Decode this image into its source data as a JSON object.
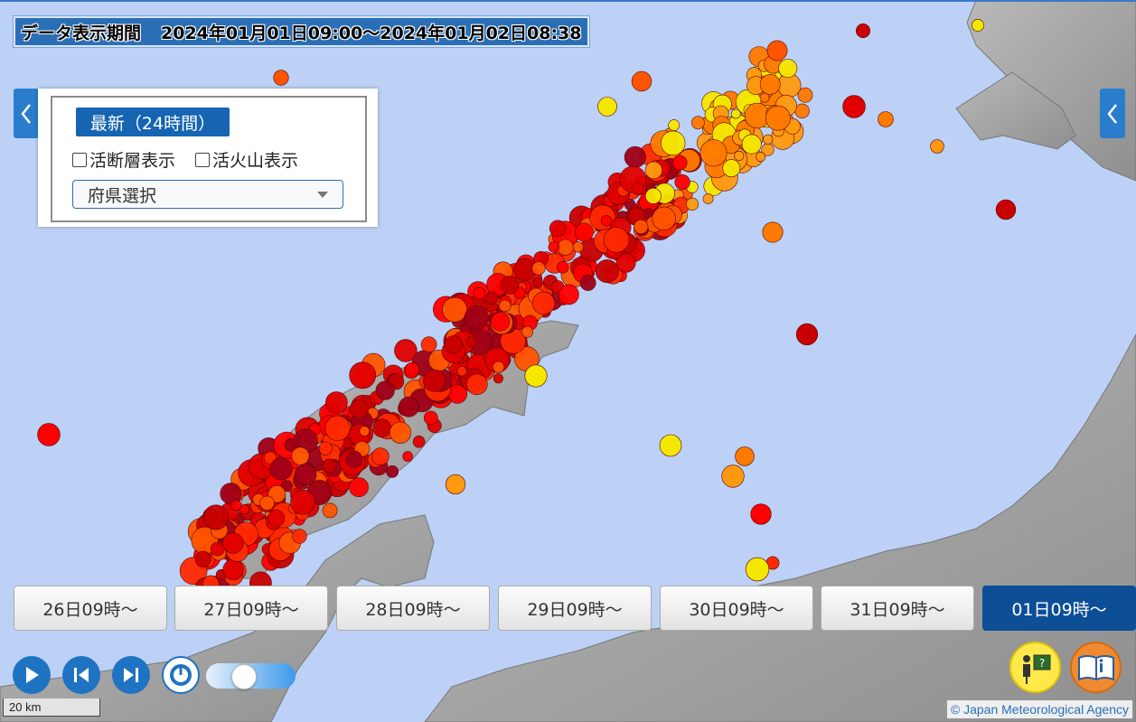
{
  "header": {
    "period_label": "データ表示期間",
    "period_range": "2024年01月01日09:00～2024年01月02日08:38"
  },
  "panel": {
    "latest_button": "最新（24時間）",
    "fault_checkbox": "活断層表示",
    "volcano_checkbox": "活火山表示",
    "prefecture_select": "府県選択"
  },
  "day_buttons": [
    "26日09時～",
    "27日09時～",
    "28日09時～",
    "29日09時～",
    "30日09時～",
    "31日09時～",
    "01日09時～"
  ],
  "active_day_index": 6,
  "slider_level": 0.4,
  "scale_label": "20 km",
  "credit": "© Japan Meteorological Agency",
  "colors": {
    "accent": "#1665b2",
    "active_day": "#0c4f97",
    "sea": "#bcd1f5"
  },
  "icons": [
    "chevron-left-icon",
    "play-icon",
    "skip-back-icon",
    "skip-forward-icon",
    "speed-gauge-icon",
    "help-person-icon",
    "info-book-icon"
  ]
}
